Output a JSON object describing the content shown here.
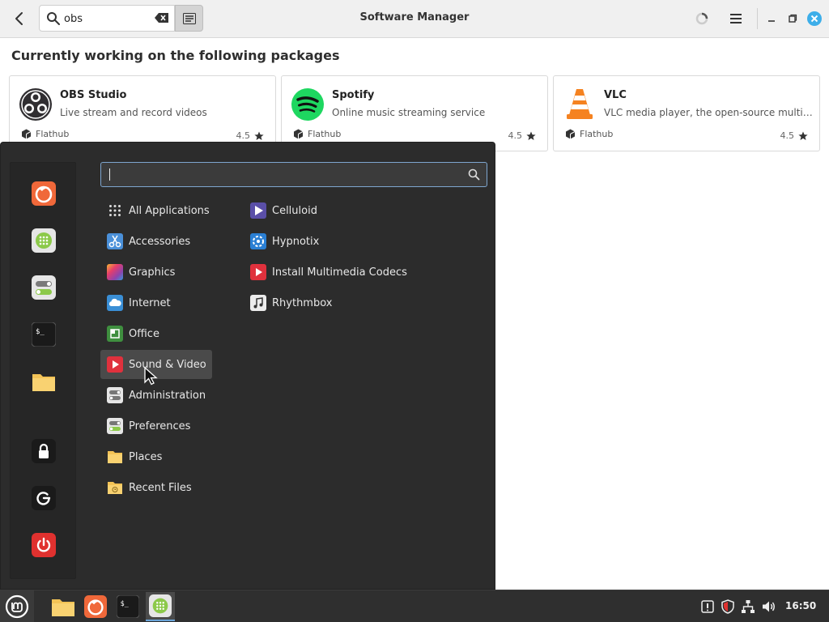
{
  "header": {
    "title": "Software Manager",
    "search_value": "obs",
    "back_icon": "chevron-left-icon",
    "clear_icon": "backspace-icon",
    "filter_icon": "search-options-icon",
    "menu_icon": "hamburger-icon"
  },
  "section_title": "Currently working on the following packages",
  "packages": [
    {
      "name": "OBS Studio",
      "description": "Live stream and record videos",
      "source": "Flathub",
      "rating": "4.5",
      "icon": "obs-icon"
    },
    {
      "name": "Spotify",
      "description": "Online music streaming service",
      "source": "Flathub",
      "rating": "4.5",
      "icon": "spotify-icon"
    },
    {
      "name": "VLC",
      "description": "VLC media player, the open-source multimedia player",
      "source": "Flathub",
      "rating": "4.5",
      "icon": "vlc-icon"
    }
  ],
  "menu": {
    "search_value": "",
    "favorites": [
      "firefox-icon",
      "software-manager-icon",
      "settings-toggle-icon",
      "terminal-icon",
      "folder-icon"
    ],
    "session": [
      "lock-icon",
      "logout-icon",
      "power-icon"
    ],
    "categories": [
      {
        "label": "All Applications",
        "icon": "grid-icon"
      },
      {
        "label": "Accessories",
        "icon": "scissors-icon"
      },
      {
        "label": "Graphics",
        "icon": "palette-icon"
      },
      {
        "label": "Internet",
        "icon": "cloud-icon"
      },
      {
        "label": "Office",
        "icon": "office-icon"
      },
      {
        "label": "Sound & Video",
        "icon": "play-icon",
        "selected": true
      },
      {
        "label": "Administration",
        "icon": "admin-toggle-icon"
      },
      {
        "label": "Preferences",
        "icon": "preferences-toggle-icon"
      },
      {
        "label": "Places",
        "icon": "folder-icon"
      },
      {
        "label": "Recent Files",
        "icon": "recent-folder-icon"
      }
    ],
    "apps": [
      {
        "label": "Celluloid",
        "icon": "celluloid-icon"
      },
      {
        "label": "Hypnotix",
        "icon": "hypnotix-icon"
      },
      {
        "label": "Install Multimedia Codecs",
        "icon": "codecs-icon"
      },
      {
        "label": "Rhythmbox",
        "icon": "rhythmbox-icon"
      }
    ]
  },
  "taskbar": {
    "clock": "16:50",
    "apps": [
      "folder-icon",
      "firefox-icon",
      "terminal-icon",
      "software-manager-icon"
    ],
    "tray": [
      "update-icon",
      "shield-icon",
      "network-icon",
      "volume-icon"
    ]
  },
  "colors": {
    "accent_blue": "#3daee9",
    "firefox_orange": "#f0683a",
    "mint_green": "#8cc94a",
    "power_red": "#e0312f"
  }
}
